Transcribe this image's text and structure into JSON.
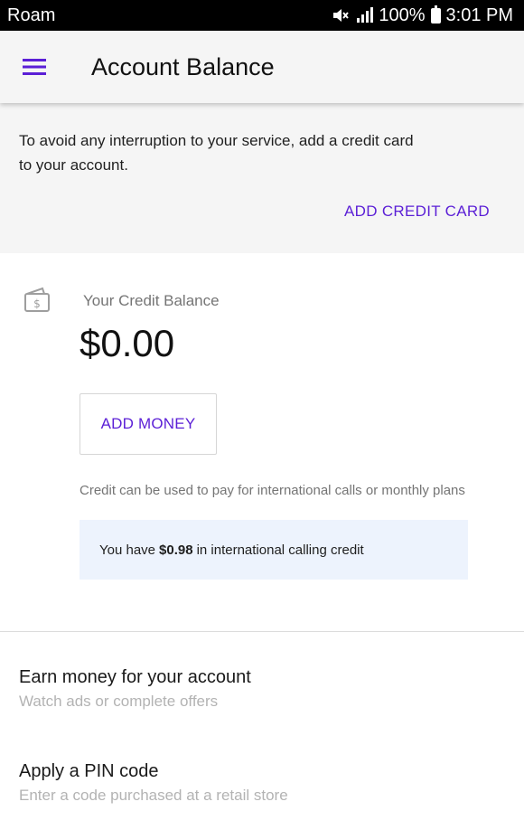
{
  "status_bar": {
    "carrier": "Roam",
    "battery": "100%",
    "time": "3:01 PM"
  },
  "app_bar": {
    "title": "Account Balance",
    "menu_icon": "hamburger-menu-icon"
  },
  "notice": {
    "text": "To avoid any interruption to your service, add a credit card to your account.",
    "action_label": "ADD CREDIT CARD"
  },
  "credit": {
    "icon": "wallet-icon",
    "label": "Your Credit Balance",
    "amount": "$0.00",
    "add_money_label": "ADD MONEY",
    "note": "Credit can be used to pay for international calls or monthly plans",
    "intl": {
      "prefix": "You have",
      "amount": "$0.98",
      "suffix": "in international calling credit"
    }
  },
  "options": [
    {
      "title": "Earn money for your account",
      "subtitle": "Watch ads or complete offers"
    },
    {
      "title": "Apply a PIN code",
      "subtitle": "Enter a code purchased at a retail store"
    }
  ],
  "colors": {
    "accent": "#5b1fd6",
    "banner_bg": "#f5f5f5",
    "info_box_bg": "#edf3fd"
  }
}
